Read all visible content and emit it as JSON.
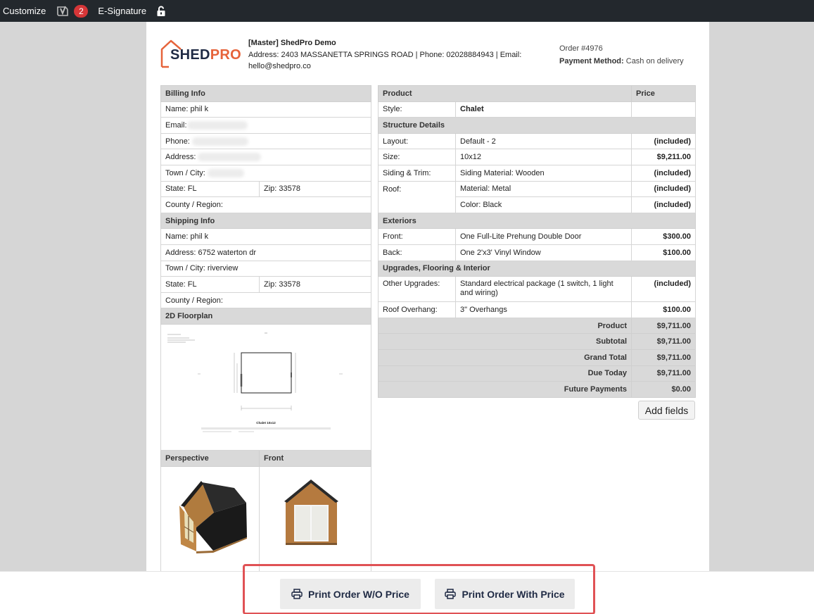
{
  "adminbar": {
    "customize": "Customize",
    "yoast_icon": "yoast-icon",
    "notification_count": "2",
    "esignature": "E-Signature",
    "lock_icon": "lock-icon"
  },
  "company": {
    "logo_shed": "SHED",
    "logo_pro": "PRO",
    "name": "[Master] ShedPro Demo",
    "address_line": "Address: 2403 MASSANETTA SPRINGS ROAD | Phone: 02028884943 | Email:",
    "email": "hello@shedpro.co"
  },
  "order": {
    "number": "Order #4976",
    "payment_label": "Payment Method:",
    "payment_value": "Cash on delivery"
  },
  "billing": {
    "title": "Billing Info",
    "name": "Name: phil k",
    "email_label": "Email:",
    "phone_label": "Phone:",
    "address_label": "Address:",
    "town_label": "Town / City:",
    "state": "State: FL",
    "zip": "Zip: 33578",
    "county": "County / Region:"
  },
  "shipping": {
    "title": "Shipping Info",
    "name": "Name: phil k",
    "address": "Address: 6752 waterton dr",
    "town": "Town / City: riverview",
    "state": "State: FL",
    "zip": "Zip: 33578",
    "county": "County / Region:"
  },
  "images": {
    "floorplan_title": "2D Floorplan",
    "floorplan_caption": "Chalet 10x12",
    "perspective_title": "Perspective",
    "front_title": "Front"
  },
  "product": {
    "col_product": "Product",
    "col_price": "Price",
    "style_label": "Style:",
    "style_value": "Chalet",
    "structure_title": "Structure Details",
    "rows_structure": [
      {
        "label": "Layout:",
        "value": "Default - 2",
        "price": "(included)"
      },
      {
        "label": "Size:",
        "value": "10x12",
        "price": "$9,211.00"
      },
      {
        "label": "Siding & Trim:",
        "value": "Siding Material: Wooden",
        "price": "(included)"
      },
      {
        "label": "Roof:",
        "value": "Material: Metal",
        "price": "(included)"
      },
      {
        "label": "",
        "value": "Color: Black",
        "price": "(included)"
      }
    ],
    "exteriors_title": "Exteriors",
    "rows_exteriors": [
      {
        "label": "Front:",
        "value": "One Full-Lite Prehung Double Door",
        "price": "$300.00"
      },
      {
        "label": "Back:",
        "value": "One 2'x3' Vinyl Window",
        "price": "$100.00"
      }
    ],
    "upgrades_title": "Upgrades, Flooring & Interior",
    "rows_upgrades": [
      {
        "label": "Other Upgrades:",
        "value": "Standard electrical package (1 switch, 1 light and wiring)",
        "price": "(included)"
      },
      {
        "label": "Roof Overhang:",
        "value": "3\" Overhangs",
        "price": "$100.00"
      }
    ],
    "totals": [
      {
        "label": "Product",
        "value": "$9,711.00"
      },
      {
        "label": "Subtotal",
        "value": "$9,711.00"
      },
      {
        "label": "Grand Total",
        "value": "$9,711.00"
      },
      {
        "label": "Due Today",
        "value": "$9,711.00"
      },
      {
        "label": "Future Payments",
        "value": "$0.00"
      }
    ],
    "add_fields": "Add fields"
  },
  "actions": {
    "print_without_price": "Print Order W/O Price",
    "print_with_price": "Print Order With Price",
    "print_icon": "printer-icon",
    "highlight_color": "#e05255"
  },
  "colors": {
    "admin_bar": "#23282d",
    "badge": "#d63638",
    "table_header": "#d9d9d9",
    "brand_dark": "#1f2a44",
    "brand_orange": "#e6633a"
  }
}
